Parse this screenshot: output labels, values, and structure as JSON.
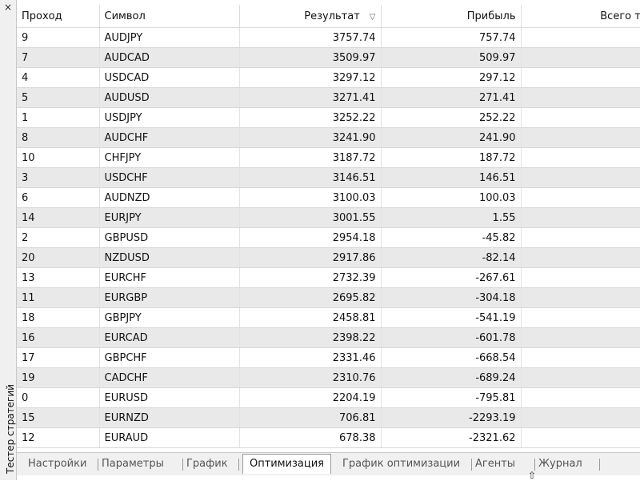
{
  "side_panel": {
    "close_glyph": "×",
    "title": "Тестер стратегий"
  },
  "table": {
    "headers": {
      "pass": "Проход",
      "symbol": "Символ",
      "result": "Результат",
      "profit": "Прибыль",
      "trades": "Всего трейд"
    },
    "sort_icon": "▽",
    "rows": [
      {
        "pass": "9",
        "symbol": "AUDJPY",
        "result": "3757.74",
        "profit": "757.74"
      },
      {
        "pass": "7",
        "symbol": "AUDCAD",
        "result": "3509.97",
        "profit": "509.97"
      },
      {
        "pass": "4",
        "symbol": "USDCAD",
        "result": "3297.12",
        "profit": "297.12"
      },
      {
        "pass": "5",
        "symbol": "AUDUSD",
        "result": "3271.41",
        "profit": "271.41"
      },
      {
        "pass": "1",
        "symbol": "USDJPY",
        "result": "3252.22",
        "profit": "252.22"
      },
      {
        "pass": "8",
        "symbol": "AUDCHF",
        "result": "3241.90",
        "profit": "241.90"
      },
      {
        "pass": "10",
        "symbol": "CHFJPY",
        "result": "3187.72",
        "profit": "187.72"
      },
      {
        "pass": "3",
        "symbol": "USDCHF",
        "result": "3146.51",
        "profit": "146.51"
      },
      {
        "pass": "6",
        "symbol": "AUDNZD",
        "result": "3100.03",
        "profit": "100.03"
      },
      {
        "pass": "14",
        "symbol": "EURJPY",
        "result": "3001.55",
        "profit": "1.55"
      },
      {
        "pass": "2",
        "symbol": "GBPUSD",
        "result": "2954.18",
        "profit": "-45.82"
      },
      {
        "pass": "20",
        "symbol": "NZDUSD",
        "result": "2917.86",
        "profit": "-82.14"
      },
      {
        "pass": "13",
        "symbol": "EURCHF",
        "result": "2732.39",
        "profit": "-267.61"
      },
      {
        "pass": "11",
        "symbol": "EURGBP",
        "result": "2695.82",
        "profit": "-304.18"
      },
      {
        "pass": "18",
        "symbol": "GBPJPY",
        "result": "2458.81",
        "profit": "-541.19"
      },
      {
        "pass": "16",
        "symbol": "EURCAD",
        "result": "2398.22",
        "profit": "-601.78"
      },
      {
        "pass": "17",
        "symbol": "GBPCHF",
        "result": "2331.46",
        "profit": "-668.54"
      },
      {
        "pass": "19",
        "symbol": "CADCHF",
        "result": "2310.76",
        "profit": "-689.24"
      },
      {
        "pass": "0",
        "symbol": "EURUSD",
        "result": "2204.19",
        "profit": "-795.81"
      },
      {
        "pass": "15",
        "symbol": "EURNZD",
        "result": "706.81",
        "profit": "-2293.19"
      },
      {
        "pass": "12",
        "symbol": "EURAUD",
        "result": "678.38",
        "profit": "-2321.62"
      }
    ]
  },
  "tabs": [
    {
      "label": "Настройки",
      "active": false
    },
    {
      "label": "Параметры",
      "active": false
    },
    {
      "label": "График",
      "active": false
    },
    {
      "label": "Оптимизация",
      "active": true
    },
    {
      "label": "График оптимизации",
      "active": false
    },
    {
      "label": "Агенты",
      "active": false
    },
    {
      "label": "Журнал",
      "active": false
    }
  ],
  "cursor_glyph": "⇧"
}
